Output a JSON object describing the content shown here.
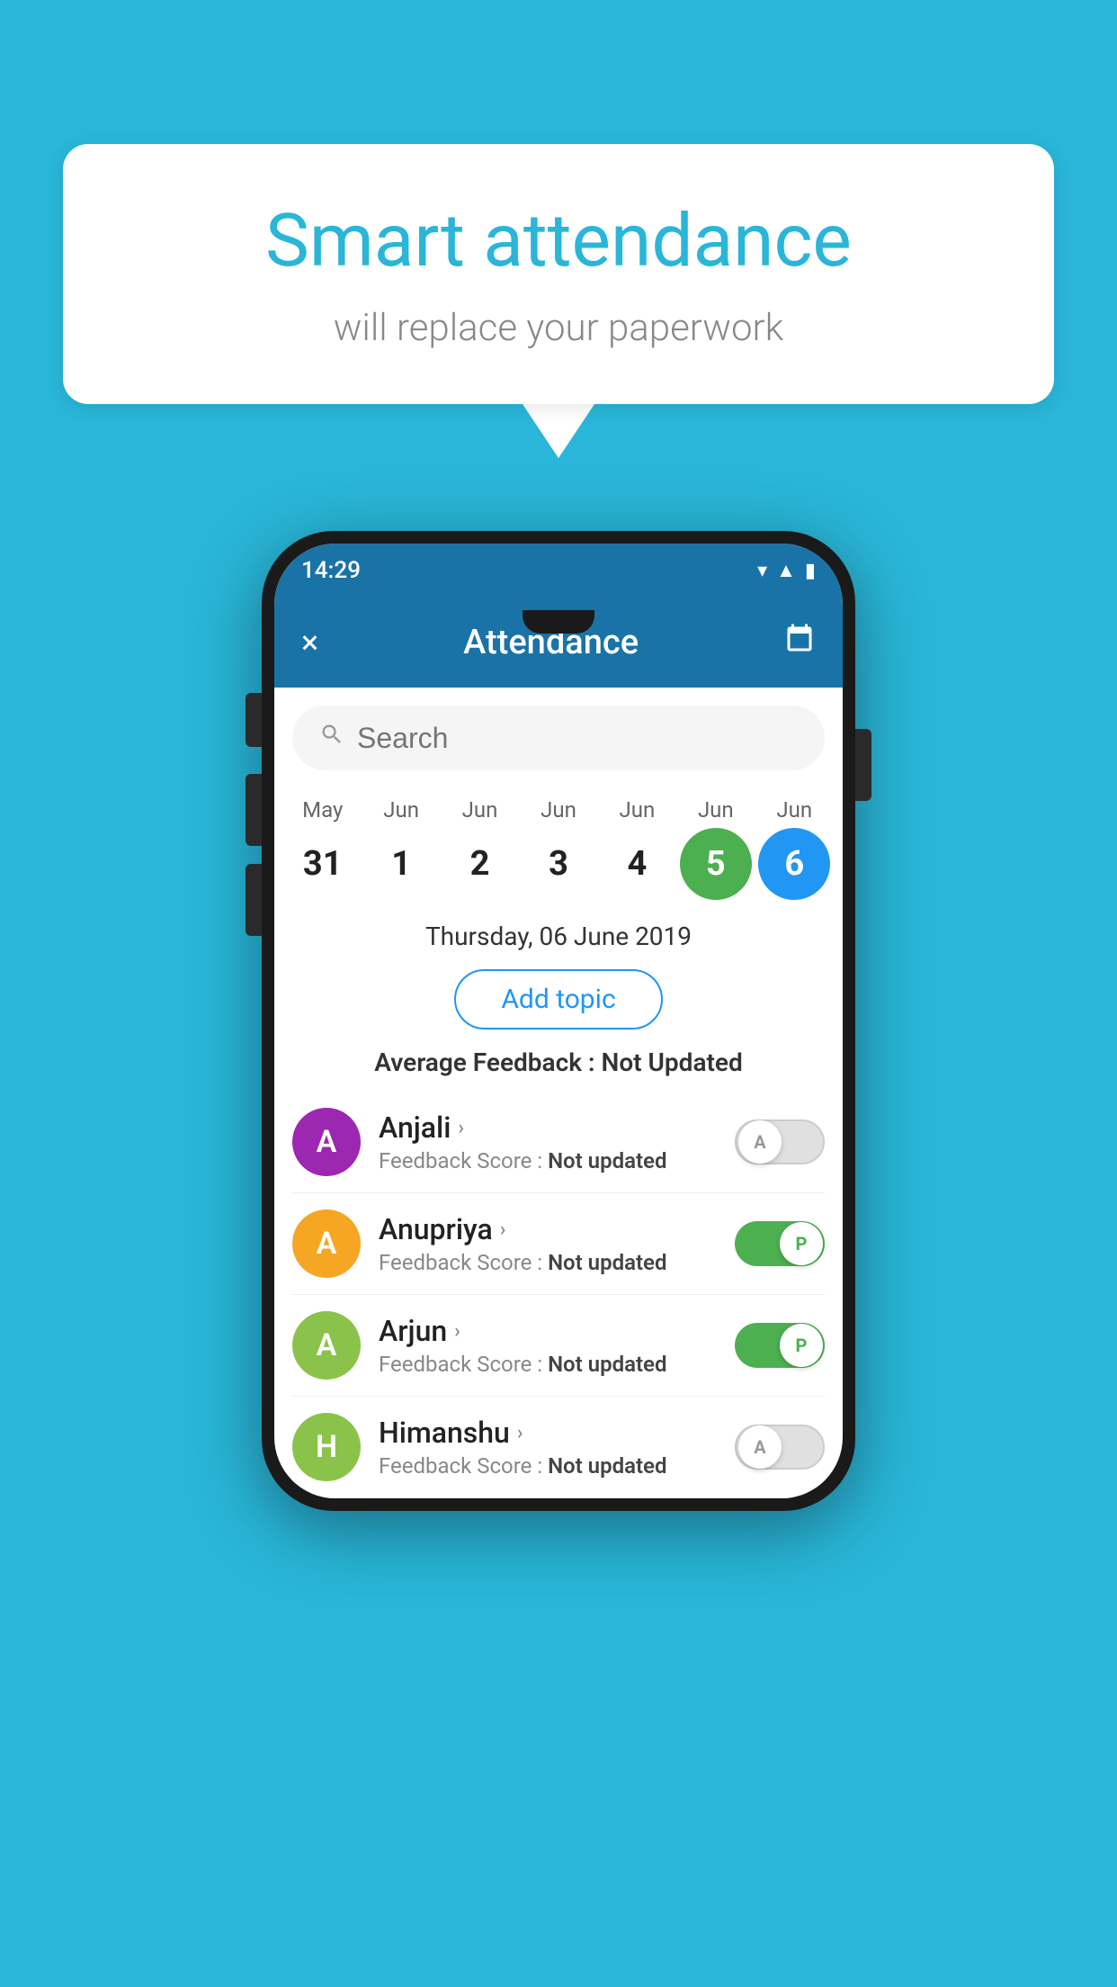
{
  "background_color": "#29b6d8",
  "speech_bubble": {
    "title": "Smart attendance",
    "subtitle": "will replace your paperwork"
  },
  "status_bar": {
    "time": "14:29",
    "icons": [
      "wifi",
      "signal",
      "battery"
    ]
  },
  "app_bar": {
    "close_label": "×",
    "title": "Attendance",
    "calendar_icon": "📅"
  },
  "search": {
    "placeholder": "Search"
  },
  "calendar": {
    "months": [
      "May",
      "Jun",
      "Jun",
      "Jun",
      "Jun",
      "Jun",
      "Jun"
    ],
    "dates": [
      "31",
      "1",
      "2",
      "3",
      "4",
      "5",
      "6"
    ],
    "today_index": 5,
    "selected_index": 6
  },
  "selected_date_label": "Thursday, 06 June 2019",
  "add_topic_button": "Add topic",
  "average_feedback": {
    "label": "Average Feedback :",
    "value": "Not Updated"
  },
  "students": [
    {
      "name": "Anjali",
      "avatar_letter": "A",
      "avatar_color": "#9c27b0",
      "feedback_label": "Feedback Score :",
      "feedback_value": "Not updated",
      "toggle_state": "off",
      "toggle_letter": "A"
    },
    {
      "name": "Anupriya",
      "avatar_letter": "A",
      "avatar_color": "#f5a623",
      "feedback_label": "Feedback Score :",
      "feedback_value": "Not updated",
      "toggle_state": "on",
      "toggle_letter": "P"
    },
    {
      "name": "Arjun",
      "avatar_letter": "A",
      "avatar_color": "#8bc34a",
      "feedback_label": "Feedback Score :",
      "feedback_value": "Not updated",
      "toggle_state": "on",
      "toggle_letter": "P"
    },
    {
      "name": "Himanshu",
      "avatar_letter": "H",
      "avatar_color": "#8bc34a",
      "feedback_label": "Feedback Score :",
      "feedback_value": "Not updated",
      "toggle_state": "off",
      "toggle_letter": "A"
    }
  ]
}
